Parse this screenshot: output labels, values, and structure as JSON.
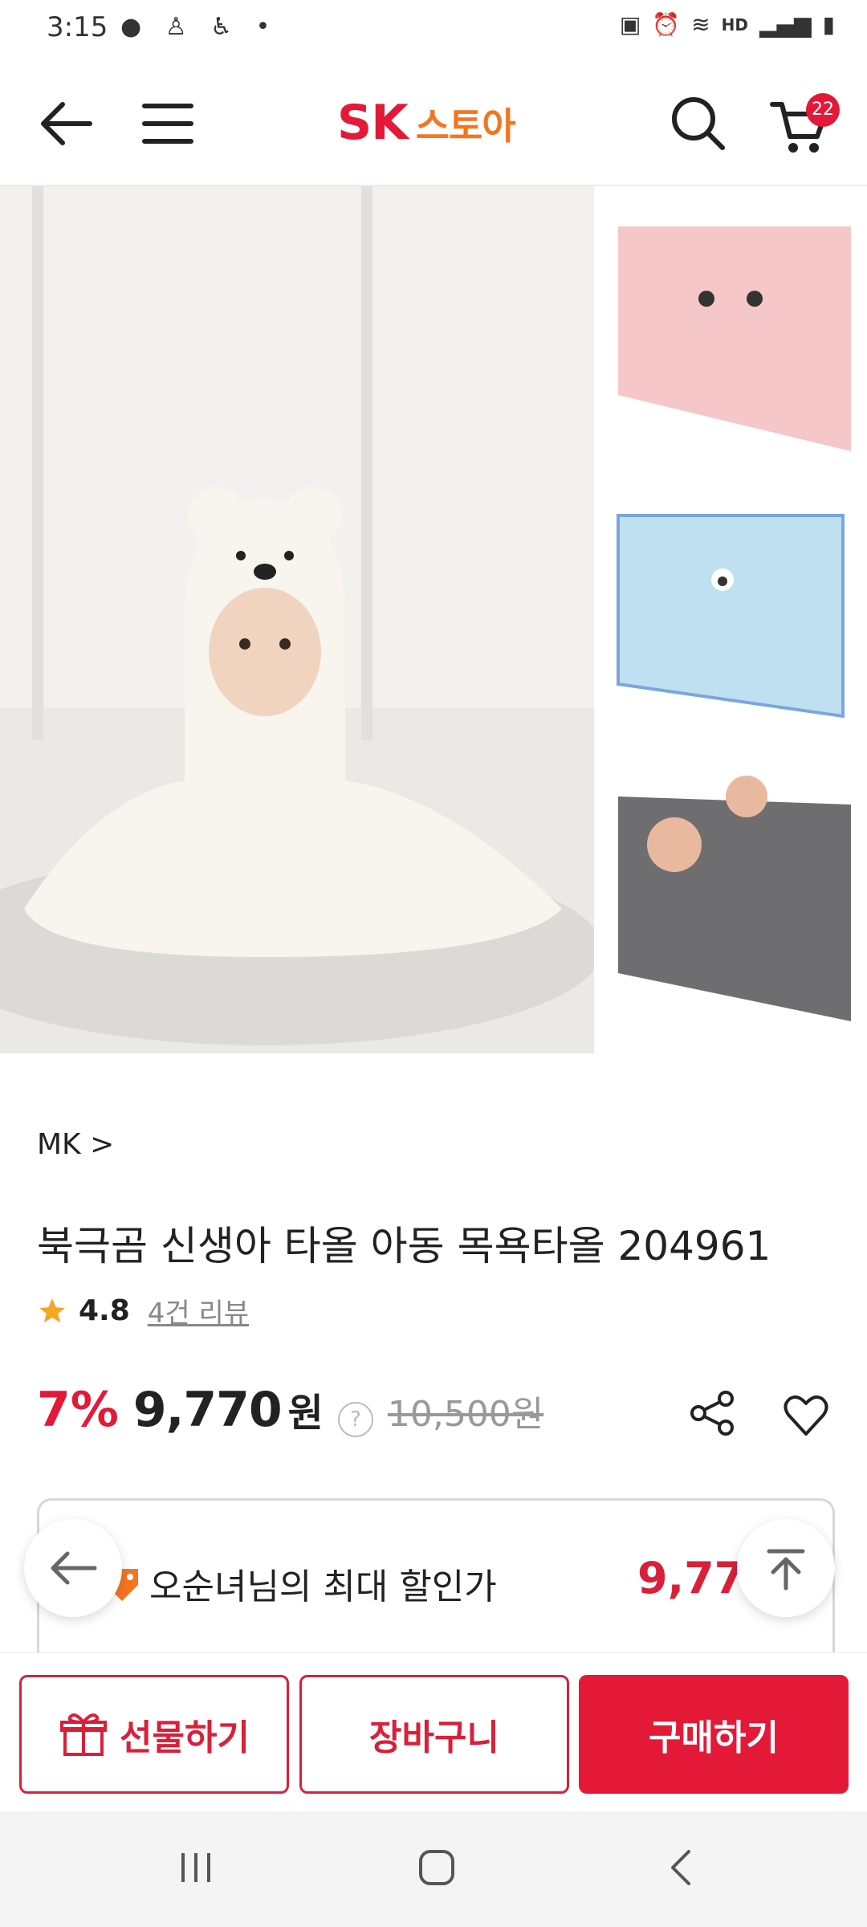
{
  "status_bar": {
    "time": "3:15",
    "hd_label": "HD"
  },
  "header": {
    "logo_sk": "SK",
    "logo_store": "스토아",
    "cart_count": "22"
  },
  "product": {
    "brand": "MK",
    "brand_chevron": ">",
    "title": "북극곰 신생아 타올 아동 목욕타올 204961",
    "rating": "4.8",
    "review_link": "4건 리뷰",
    "discount": "7%",
    "price": "9,770",
    "currency": "원",
    "help": "?",
    "original_price": "10,500원"
  },
  "max_discount": {
    "label": "오순녀님의 최대 할인가",
    "price": "9,770"
  },
  "bottom_actions": {
    "gift": "선물하기",
    "cart": "장바구니",
    "buy": "구매하기"
  },
  "colors": {
    "accent": "#e31937",
    "logo_orange": "#f47521"
  },
  "icons": [
    "back-icon",
    "menu-icon",
    "search-icon",
    "cart-icon",
    "star-icon",
    "share-icon",
    "heart-icon",
    "gift-icon",
    "scroll-top-icon",
    "tag-icon"
  ]
}
